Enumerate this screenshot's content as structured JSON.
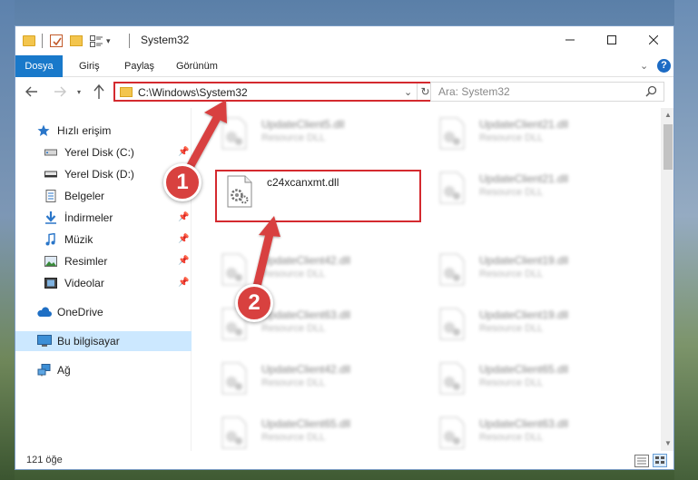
{
  "window": {
    "title": "System32"
  },
  "ribbon": {
    "tabs": [
      "Dosya",
      "Giriş",
      "Paylaş",
      "Görünüm"
    ]
  },
  "address": {
    "path": "C:\\Windows\\System32",
    "search_placeholder": "Ara: System32"
  },
  "sidebar": {
    "items": [
      {
        "label": "Hızlı erişim",
        "icon": "star-icon",
        "pinned": false
      },
      {
        "label": "Yerel Disk (C:)",
        "icon": "drive-icon",
        "pinned": true
      },
      {
        "label": "Yerel Disk (D:)",
        "icon": "drive-icon",
        "pinned": false
      },
      {
        "label": "Belgeler",
        "icon": "document-icon",
        "pinned": true
      },
      {
        "label": "İndirmeler",
        "icon": "download-icon",
        "pinned": true
      },
      {
        "label": "Müzik",
        "icon": "music-icon",
        "pinned": true
      },
      {
        "label": "Resimler",
        "icon": "pictures-icon",
        "pinned": true
      },
      {
        "label": "Videolar",
        "icon": "video-icon",
        "pinned": true
      },
      {
        "label": "OneDrive",
        "icon": "cloud-icon",
        "pinned": false
      },
      {
        "label": "Bu bilgisayar",
        "icon": "computer-icon",
        "pinned": false,
        "selected": true
      },
      {
        "label": "Ağ",
        "icon": "network-icon",
        "pinned": false
      }
    ]
  },
  "files": {
    "highlighted": {
      "name": "c24xcanxmt.dll",
      "type": ""
    },
    "left": [
      {
        "name": "UpdateClient5.dll",
        "type": "Resource DLL"
      },
      {
        "name": "UpdateClient42.dll",
        "type": "Resource DLL"
      },
      {
        "name": "UpdateClient63.dll",
        "type": "Resource DLL"
      },
      {
        "name": "UpdateClient42.dll",
        "type": "Resource DLL"
      },
      {
        "name": "UpdateClient65.dll",
        "type": "Resource DLL"
      }
    ],
    "right": [
      {
        "name": "UpdateClient21.dll",
        "type": "Resource DLL"
      },
      {
        "name": "UpdateClient21.dll",
        "type": "Resource DLL"
      },
      {
        "name": "UpdateClient19.dll",
        "type": "Resource DLL"
      },
      {
        "name": "UpdateClient19.dll",
        "type": "Resource DLL"
      },
      {
        "name": "UpdateClient65.dll",
        "type": "Resource DLL"
      },
      {
        "name": "UpdateClient63.dll",
        "type": "Resource DLL"
      }
    ]
  },
  "status": {
    "count": "121 öğe"
  },
  "annotations": {
    "badge1": "1",
    "badge2": "2"
  },
  "colors": {
    "accent": "#1979ca",
    "highlight": "#d42a2f",
    "badge": "#d8413f",
    "selected": "#cce8ff"
  }
}
